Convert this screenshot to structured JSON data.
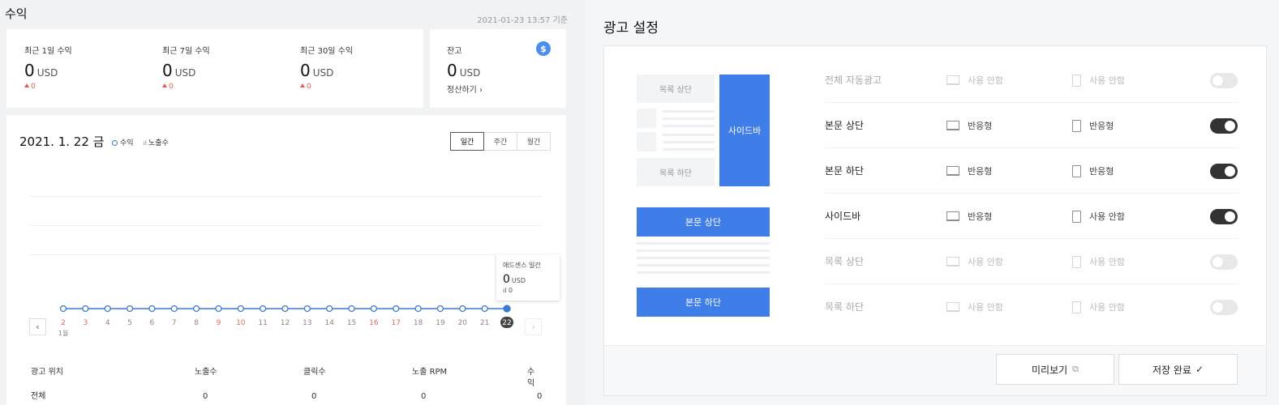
{
  "revenue": {
    "title": "수익",
    "timestamp": "2021-01-23 13:57 기준",
    "stats": [
      {
        "label": "최근 1일 수익",
        "value": "0",
        "unit": "USD",
        "change": "0"
      },
      {
        "label": "최근 7일 수익",
        "value": "0",
        "unit": "USD",
        "change": "0"
      },
      {
        "label": "최근 30일 수익",
        "value": "0",
        "unit": "USD",
        "change": "0"
      }
    ],
    "balance": {
      "label": "잔고",
      "value": "0",
      "unit": "USD",
      "settle": "정산하기 ›",
      "icon": "dollar-icon",
      "icon_glyph": "$"
    }
  },
  "chart": {
    "date": "2021. 1. 22 금",
    "legend": {
      "revenue": "수익",
      "impressions": "노출수",
      "impressions_glyph": "ıl"
    },
    "periods": [
      "일간",
      "주간",
      "월간"
    ],
    "active_period": "일간",
    "tooltip": {
      "label": "애드센스 일간",
      "value": "0",
      "unit": "USD",
      "impressions": "ıl 0"
    },
    "prev_glyph": "‹",
    "next_glyph": "›"
  },
  "chart_data": {
    "type": "line",
    "x": [
      "2",
      "3",
      "4",
      "5",
      "6",
      "7",
      "8",
      "9",
      "10",
      "11",
      "12",
      "13",
      "14",
      "15",
      "16",
      "17",
      "18",
      "19",
      "20",
      "21",
      "22"
    ],
    "x_sublabel": "1월",
    "highlight": "22",
    "weekend_x": [
      "2",
      "3",
      "9",
      "10",
      "16",
      "17"
    ],
    "series": [
      {
        "name": "수익",
        "values": [
          0,
          0,
          0,
          0,
          0,
          0,
          0,
          0,
          0,
          0,
          0,
          0,
          0,
          0,
          0,
          0,
          0,
          0,
          0,
          0,
          0
        ]
      }
    ],
    "color": "#3a7bd5",
    "grid": true
  },
  "table": {
    "headers": [
      "광고 위치",
      "노출수",
      "클릭수",
      "노출 RPM",
      "수익"
    ],
    "rows": [
      [
        "전체",
        "0",
        "0",
        "0",
        "0"
      ]
    ]
  },
  "ad_settings": {
    "title": "광고 설정",
    "preview": {
      "list_top": "목록 상단",
      "list_bottom": "목록 하단",
      "sidebar": "사이드바",
      "body_top": "본문 상단",
      "body_bottom": "본문 하단"
    },
    "rows": [
      {
        "label": "전체 자동광고",
        "pc": "사용 안함",
        "mobile": "사용 안함",
        "enabled": false
      },
      {
        "label": "본문 상단",
        "pc": "반응형",
        "mobile": "반응형",
        "enabled": true
      },
      {
        "label": "본문 하단",
        "pc": "반응형",
        "mobile": "반응형",
        "enabled": true
      },
      {
        "label": "사이드바",
        "pc": "반응형",
        "mobile": "사용 안함",
        "enabled": true
      },
      {
        "label": "목록 상단",
        "pc": "사용 안함",
        "mobile": "사용 안함",
        "enabled": false
      },
      {
        "label": "목록 하단",
        "pc": "사용 안함",
        "mobile": "사용 안함",
        "enabled": false
      }
    ],
    "preview_button": "미리보기",
    "preview_icon": "⧉",
    "save_button": "저장 완료",
    "save_icon": "✓"
  },
  "colors": {
    "accent": "#3f7de8",
    "toggle_on": "#333333",
    "toggle_off": "#e8e8e8",
    "change": "#e85a4f"
  }
}
